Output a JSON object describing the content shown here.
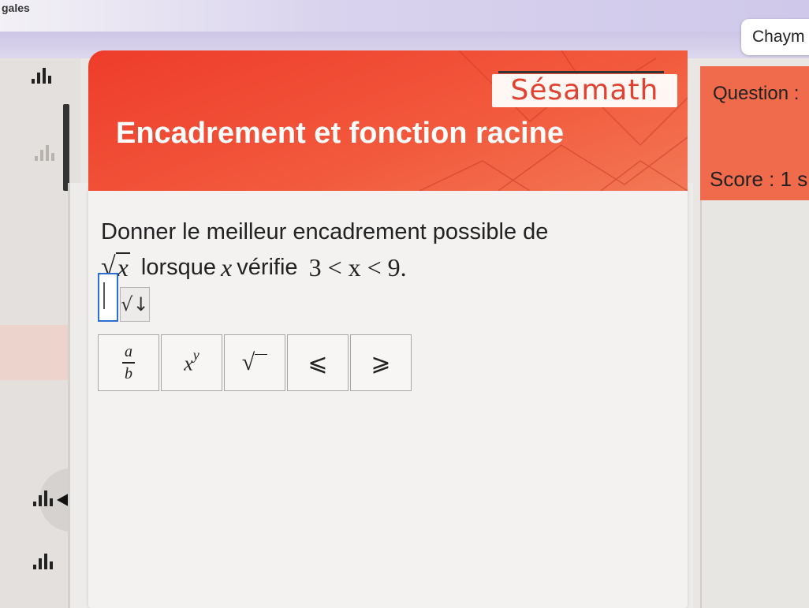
{
  "topbar": {
    "title": "gales"
  },
  "user": {
    "name": "Chaym"
  },
  "banner": {
    "brand": "Sésamath",
    "title": "Encadrement et fonction racine"
  },
  "info": {
    "question_label": "Question :",
    "score_label": "Score : 1 s"
  },
  "exercise": {
    "prompt": "Donner le meilleur encadrement possible de",
    "radicand": "x",
    "condition_text": "lorsque",
    "variable": "x",
    "condition_verb": "vérifie",
    "inequality": "3 < x < 9."
  },
  "answer": {
    "value": ""
  },
  "dropdown": {
    "icon": "sqrt-down-arrow-icon",
    "glyph": "√↓"
  },
  "math_keys": [
    {
      "name": "fraction-key",
      "numerator": "a",
      "denominator": "b"
    },
    {
      "name": "power-key",
      "base": "x",
      "exponent": "y"
    },
    {
      "name": "sqrt-key",
      "glyph": "√"
    },
    {
      "name": "less-equal-key",
      "glyph": "⩽"
    },
    {
      "name": "greater-equal-key",
      "glyph": "⩾"
    }
  ],
  "colors": {
    "banner": "#ee3c2b",
    "info_box": "#f06a4c",
    "focus": "#2a6fd1"
  }
}
